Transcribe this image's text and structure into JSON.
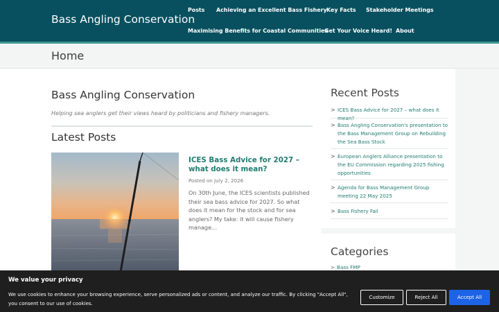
{
  "header": {
    "site_title": "Bass Angling Conservation",
    "nav": [
      "Posts",
      "Achieving an Excellent Bass Fishery",
      "Key Facts",
      "Stakeholder Meetings",
      "Maximising Benefits for Coastal Communities",
      "Get Your Voice Heard!",
      "About"
    ]
  },
  "page": {
    "title": "Home"
  },
  "main": {
    "blog_title": "Bass Angling Conservation",
    "tagline": "Helping sea anglers get their views heard by politicians and fishery managers.",
    "latest_heading": "Latest Posts",
    "post": {
      "title": "ICES Bass Advice for 2027 – what does it mean?",
      "date": "Posted on July 2, 2026",
      "excerpt": "On 30th June, the ICES scientists published their sea bass advice for 2027.  So what does it mean for the stock and for sea anglers? My take: it will cause fishery manage…"
    }
  },
  "sidebar": {
    "recent_title": "Recent Posts",
    "recent_posts": [
      "ICES Bass Advice for 2027 – what does it mean?",
      "Bass Angling Conservation's presentation to the Bass Management Group on Rebuilding the Sea Bass Stock",
      "European Anglers Alliance presentation to the EU Commission regarding 2025 fishing opportunities",
      "Agenda for Bass Management Group meeting 22 May 2025",
      "Bass Fishery Fail"
    ],
    "categories_title": "Categories",
    "categories": [
      "Bass FMP"
    ]
  },
  "cookie": {
    "title": "We value your privacy",
    "text": "We use cookies to enhance your browsing experience, serve personalized ads or content, and analyze our traffic. By clicking \"Accept All\", you consent to our use of cookies.",
    "customize": "Customize",
    "reject": "Reject All",
    "accept": "Accept All"
  },
  "colors": {
    "header_bg": "#08505f",
    "accent_link": "#1f7c70",
    "accept_button": "#1c63e6",
    "cookie_bg": "#1f1f1f"
  },
  "icons": {
    "list_chevron": "chevron-right-icon"
  }
}
